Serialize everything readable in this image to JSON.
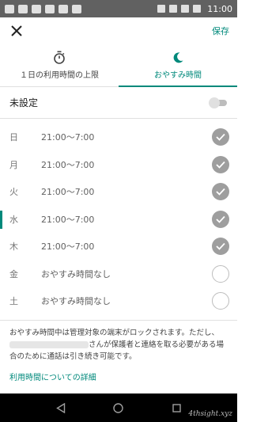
{
  "status_bar": {
    "time": "11:00"
  },
  "toolbar": {
    "save_label": "保存"
  },
  "tabs": [
    {
      "label": "１日の利用時間の上限",
      "icon": "timer-icon",
      "active": false
    },
    {
      "label": "おやすみ時間",
      "icon": "moon-icon",
      "active": true
    }
  ],
  "unset": {
    "label": "未設定",
    "toggle_on": false
  },
  "days": [
    {
      "day": "日",
      "time": "21:00〜7:00",
      "checked": true
    },
    {
      "day": "月",
      "time": "21:00〜7:00",
      "checked": true
    },
    {
      "day": "火",
      "time": "21:00〜7:00",
      "checked": true
    },
    {
      "day": "水",
      "time": "21:00〜7:00",
      "checked": true
    },
    {
      "day": "木",
      "time": "21:00〜7:00",
      "checked": true
    },
    {
      "day": "金",
      "time": "おやすみ時間なし",
      "checked": false
    },
    {
      "day": "土",
      "time": "おやすみ時間なし",
      "checked": false
    }
  ],
  "info": {
    "text_before": "おやすみ時間中は管理対象の端末がロックされます。ただし、",
    "text_after": "さんが保護者と連絡を取る必要がある場合のために通話は引き続き可能です。",
    "link": "利用時間についての詳細"
  },
  "colors": {
    "accent": "#00897b",
    "checked": "#9e9e9e",
    "status_bar": "#616161",
    "nav_bar": "#000000"
  },
  "watermark": "4thsight.xyz"
}
